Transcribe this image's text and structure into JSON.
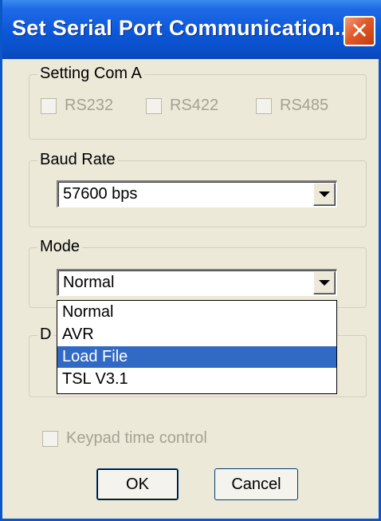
{
  "window": {
    "title": "Set Serial Port Communication...",
    "close_symbol": "✕"
  },
  "setting_com": {
    "legend": "Setting Com A",
    "options": [
      {
        "label": "RS232",
        "checked": false,
        "enabled": false
      },
      {
        "label": "RS422",
        "checked": false,
        "enabled": false
      },
      {
        "label": "RS485",
        "checked": false,
        "enabled": false
      }
    ]
  },
  "baud_rate": {
    "legend": "Baud Rate",
    "value": "57600 bps"
  },
  "mode": {
    "legend": "Mode",
    "value": "Normal",
    "dropdown_open": true,
    "options": [
      "Normal",
      "AVR",
      "Load File",
      "TSL V3.1"
    ],
    "highlighted": "Load File"
  },
  "hidden_group": {
    "legend_partial": "D"
  },
  "keypad_time_control": {
    "label": "Keypad time control",
    "checked": false,
    "enabled": false
  },
  "buttons": {
    "ok": "OK",
    "cancel": "Cancel"
  },
  "colors": {
    "titlebar": "#0a57d8",
    "close_button": "#e05a2a",
    "dialog_bg": "#ece9d8",
    "selection": "#316ac5",
    "disabled_text": "#a3a393"
  }
}
